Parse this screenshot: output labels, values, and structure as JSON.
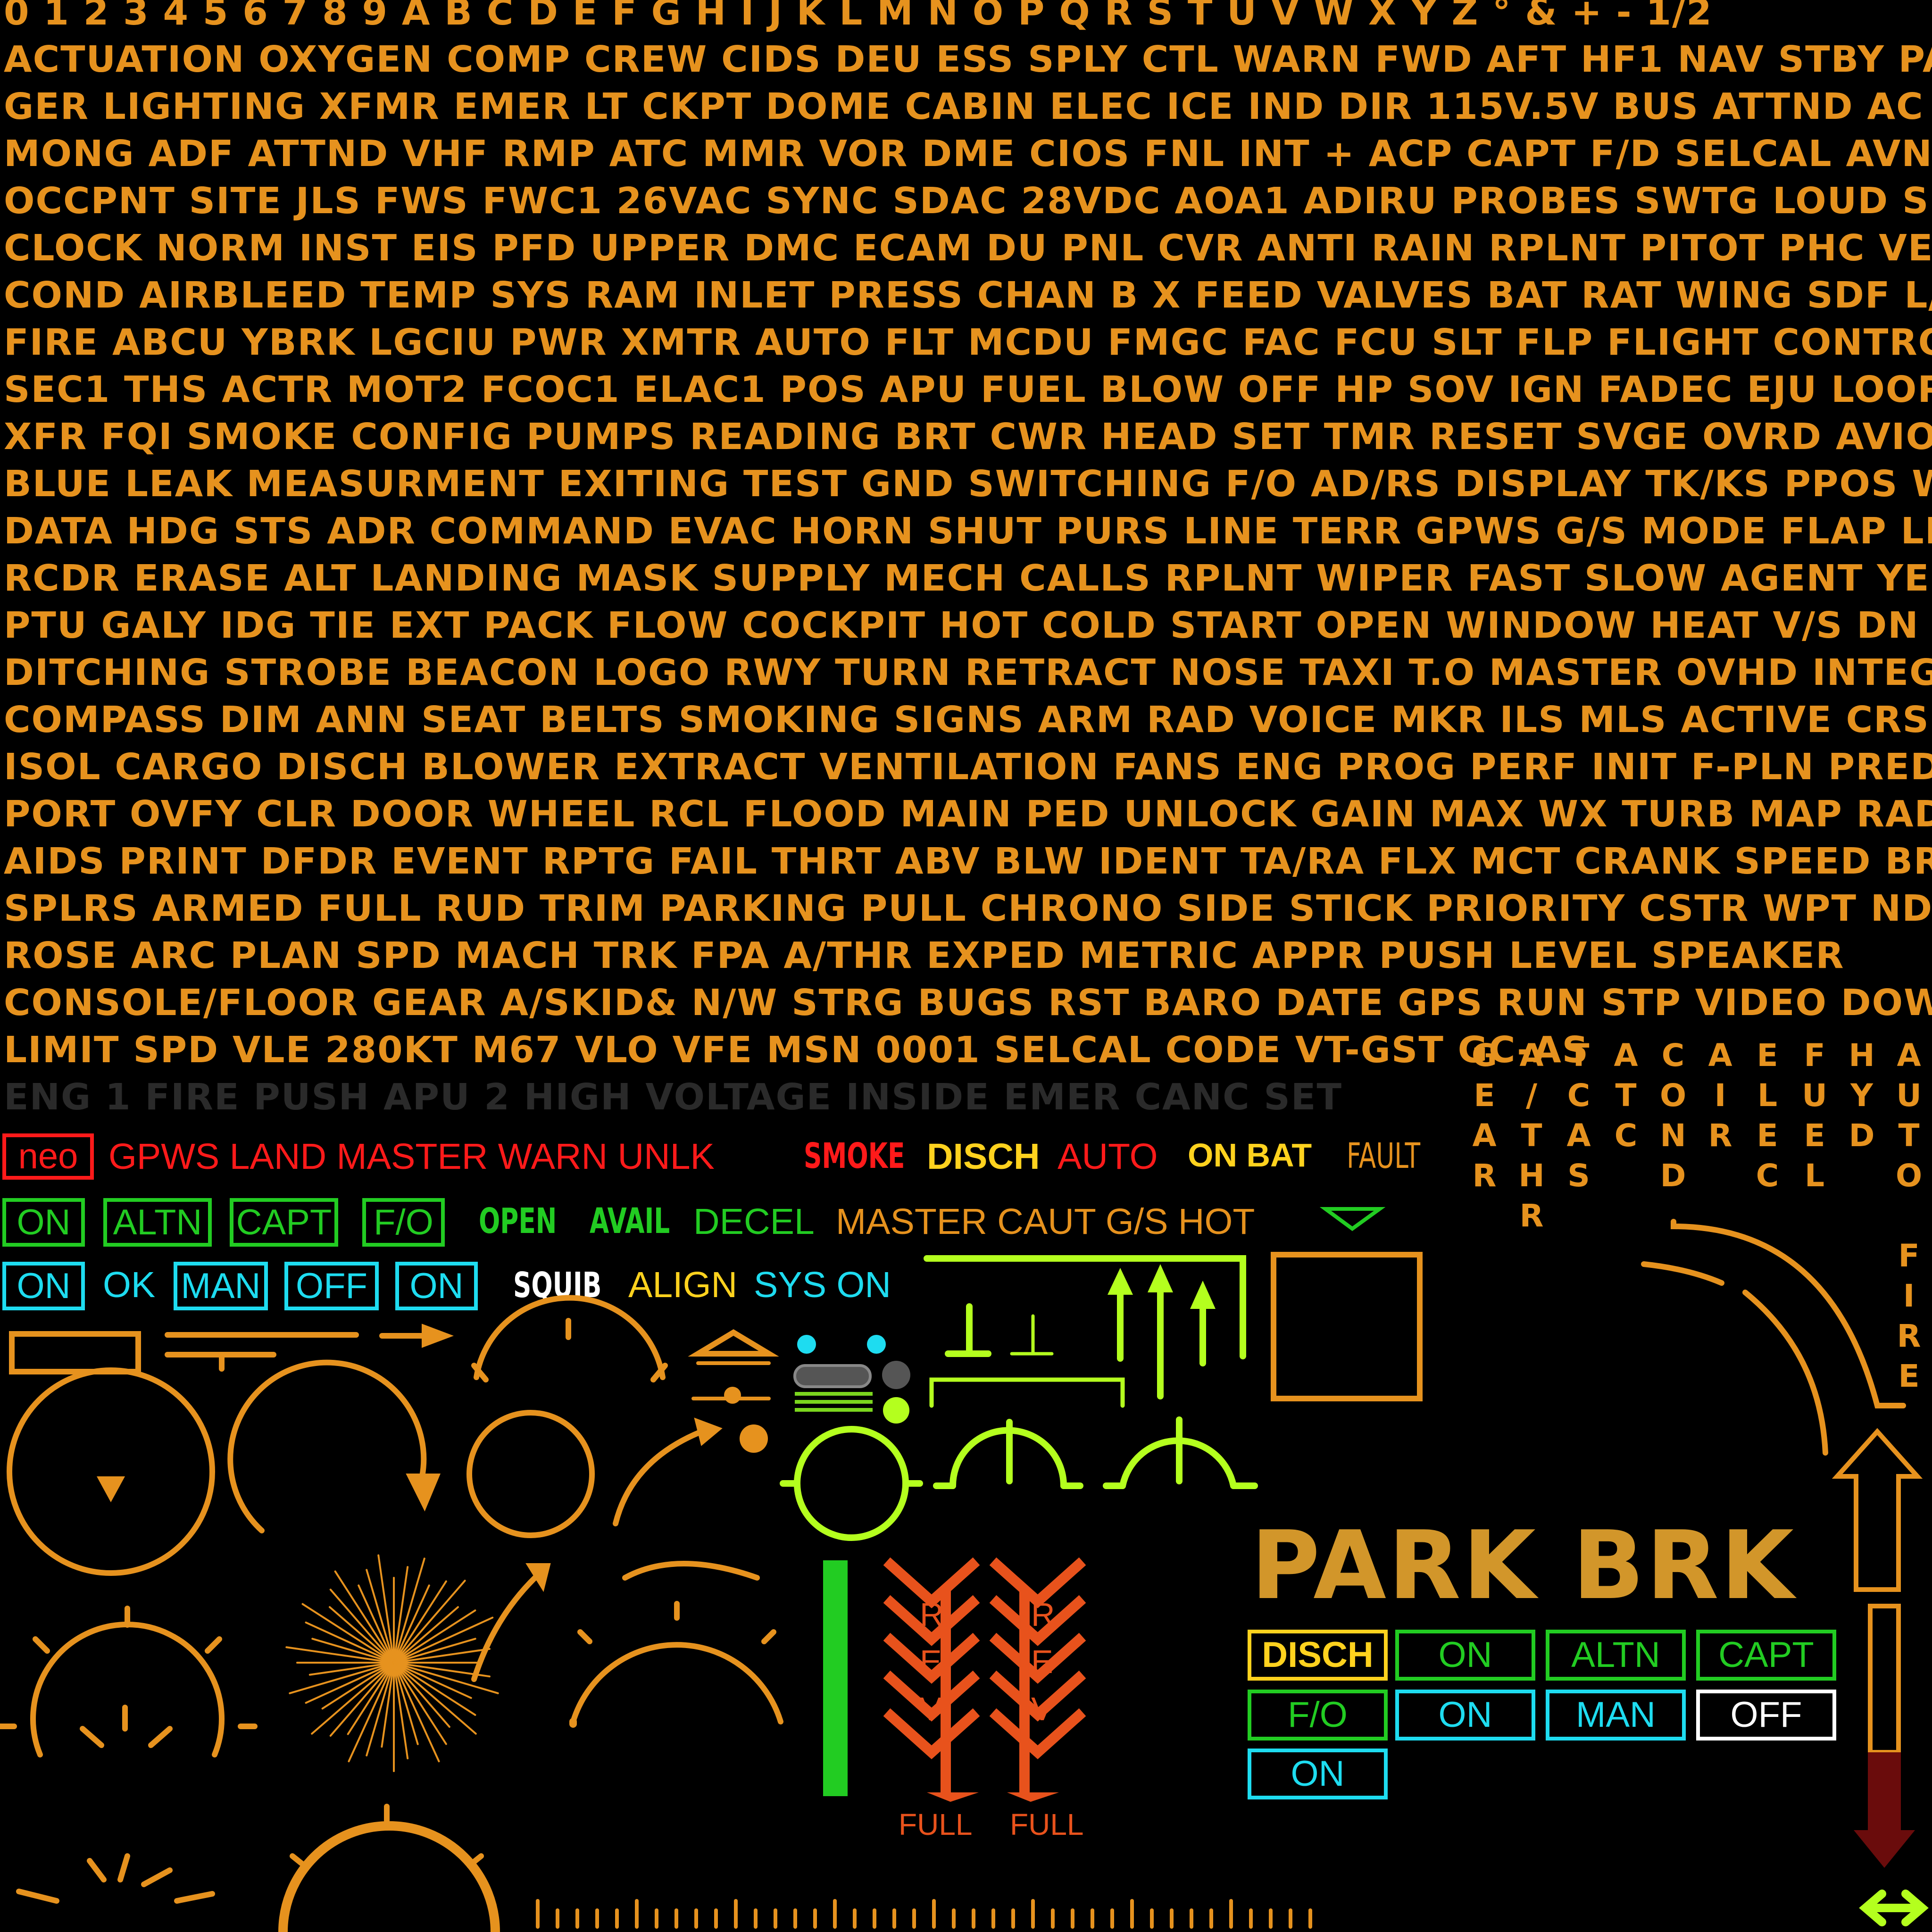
{
  "colors": {
    "amber": "#E6921E",
    "red": "#FF1A1A",
    "green": "#22CC22",
    "cyan": "#1EDCF0",
    "white": "#FFFFFF",
    "yellow": "#FFD21E",
    "lime": "#B4FF1E",
    "dim": "#2A2A2A",
    "park": "#D2962A",
    "rev": "#E8521C",
    "darkred": "#6A0C0C"
  },
  "text_lines": [
    "0 1 2 3 4 5 6 7 8 9 A B C D E F G H I J K L M N O P Q R S T U V W X Y Z ° & + - 1/2",
    "ACTUATION OXYGEN COMP CREW CIDS DEU ESS SPLY CTL WARN FWD AFT HF1 NAV STBY PASSEN-",
    "GER  LIGHTING  XFMR EMER LT CKPT DOME CABIN ELEC ICE IND DIR 115V.5V BUS ATTND AC BXP",
    "MONG ADF ATTND VHF RMP ATC MMR VOR DME CIOS FNL INT + ACP CAPT F/D SELCAL AVNCS AUDIO",
    "OCCPNT SITE JLS FWS FWC1 26VAC SYNC SDAC 28VDC AOA1 ADIRU PROBES SWTG LOUD SPKR",
    "CLOCK NORM INST EIS PFD UPPER DMC ECAM DU PNL CVR ANTI RAIN RPLNT PITOT PHC VENT AIR",
    "COND AIRBLEED TEMP SYS RAM INLET PRESS CHAN B X FEED VALVES BAT RAT WING SDF L/G HYD",
    "FIRE ABCU YBRK LGCIU PWR XMTR AUTO FLT MCDU FMGC FAC FCU SLT FLP FLIGHT CONTROLS",
    "SEC1 THS ACTR MOT2 FCOC1 ELAC1 POS APU FUEL BLOW OFF HP SOV IGN FADEC EJU LOOP DET",
    "XFR FQI SMOKE CONFIG PUMPS READING BRT CWR HEAD SET TMR RESET SVGE OVRD AVIONICS",
    "BLUE LEAK MEASURMENT EXITING TEST GND SWITCHING F/O AD/RS DISPLAY TK/KS PPOS WIND",
    "DATA HDG STS ADR COMMAND EVAC HORN SHUT PURS LINE TERR GPWS G/S MODE FLAP LDG",
    "RCDR ERASE ALT LANDING MASK SUPPLY MECH CALLS RPLNT WIPER FAST SLOW AGENT YELLOW",
    "PTU GALY IDG TIE EXT PACK FLOW COCKPIT HOT COLD START OPEN WINDOW HEAT V/S DN ELEV",
    "DITCHING STROBE BEACON LOGO RWY TURN RETRACT NOSE TAXI T.O MASTER OVHD INTEG",
    "COMPASS DIM ANN SEAT BELTS SMOKING SIGNS ARM RAD VOICE MKR ILS MLS ACTIVE CRS BFO",
    "ISOL CARGO DISCH BLOWER EXTRACT VENTILATION FANS ENG PROG PERF INIT F-PLN PRED MENU",
    "PORT OVFY CLR DOOR WHEEL RCL FLOOD MAIN PED UNLOCK GAIN MAX WX TURB MAP RADAR TILT",
    "AIDS PRINT DFDR EVENT RPTG FAIL THRT ABV BLW IDENT TA/RA FLX MCT CRANK SPEED BRAKE",
    "SPLRS ARMED FULL RUD TRIM PARKING PULL CHRONO SIDE STICK PRIORITY CSTR WPT NDB ARPT",
    "ROSE ARC PLAN SPD MACH TRK FPA A/THR EXPED METRIC APPR PUSH LEVEL SPEAKER",
    "CONSOLE/FLOOR GEAR A/SKID& N/W STRG BUGS RST BARO DATE GPS RUN STP VIDEO DOWN",
    "LIMIT SPD VLE 280KT M67 VLO VFE MSN 0001 SELCAL CODE VT-GST GC-AS"
  ],
  "dim_line": "ENG 1 FIRE PUSH APU 2 HIGH VOLTAGE INSIDE EMER CANC SET",
  "vertical_labels": [
    "GEAR",
    "A/THR",
    "TCAS",
    "ATC",
    "COND",
    "AIR",
    "ELEC",
    "FUEL",
    "HYD",
    "AUTO FIRE"
  ],
  "row1": {
    "neo": "neo",
    "red_text": "GPWS LAND MASTER WARN UNLK",
    "smoke": "SMOKE",
    "disch": "DISCH",
    "auto": "AUTO",
    "on_bat": "ON BAT",
    "fault": "FAULT"
  },
  "row2": {
    "boxes": [
      "ON",
      "ALTN",
      "CAPT",
      "F/O"
    ],
    "open": "OPEN",
    "avail": "AVAIL",
    "decel": "DECEL",
    "master_caut": "MASTER CAUT G/S HOT"
  },
  "row3": {
    "box_on": "ON",
    "ok": "OK",
    "man": "MAN",
    "off": "OFF",
    "box_on2": "ON",
    "squib": "SQUIB",
    "align": "ALIGN",
    "sys_on": "SYS ON"
  },
  "park_brk": "PARK BRK",
  "reverser": {
    "letters": [
      "R",
      "E",
      "V"
    ],
    "full": "FULL"
  },
  "bottom_grid": {
    "disch": "DISCH",
    "on1": "ON",
    "altn": "ALTN",
    "capt": "CAPT",
    "fo": "F/O",
    "on2": "ON",
    "man": "MAN",
    "off": "OFF",
    "on3": "ON"
  }
}
